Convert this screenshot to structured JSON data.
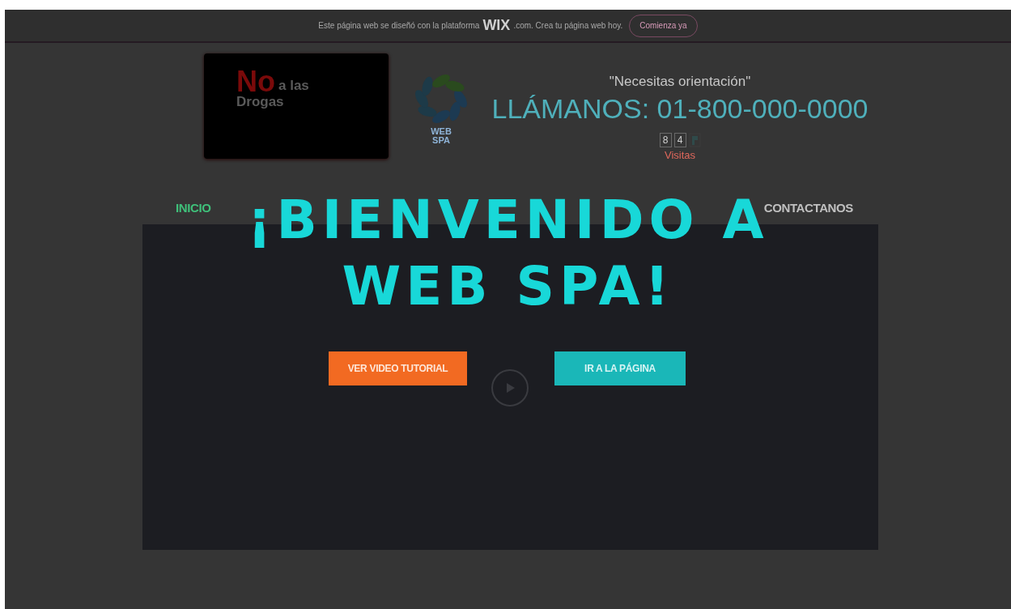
{
  "banner": {
    "text_before": "Este página web se diseñó con la plataforma",
    "brand": "WIX",
    "text_after": ".com. Crea tu página web hoy.",
    "button": "Comienza ya"
  },
  "header": {
    "badge": {
      "highlight": "No",
      "rest": "a las",
      "line2": "Drogas"
    },
    "logo": {
      "line1": "WEB",
      "line2": "SPA"
    },
    "tagline": "\"Necesitas orientación\"",
    "phone": "LLÁMANOS: 01-800-000-0000",
    "counter": [
      "8",
      "4"
    ],
    "visits": "Visitas"
  },
  "nav": [
    {
      "label": "INICIO",
      "selected": true
    },
    {
      "label": "CONTACTANOS",
      "selected": false
    }
  ],
  "welcome": {
    "title_lines": [
      "¡BIENVENIDO A",
      "WEB SPA!"
    ],
    "buttons": [
      {
        "label": "VER VIDEO TUTORIAL",
        "kind": "primary"
      },
      {
        "label": "IR A LA PÁGINA",
        "kind": "secondary"
      }
    ]
  }
}
